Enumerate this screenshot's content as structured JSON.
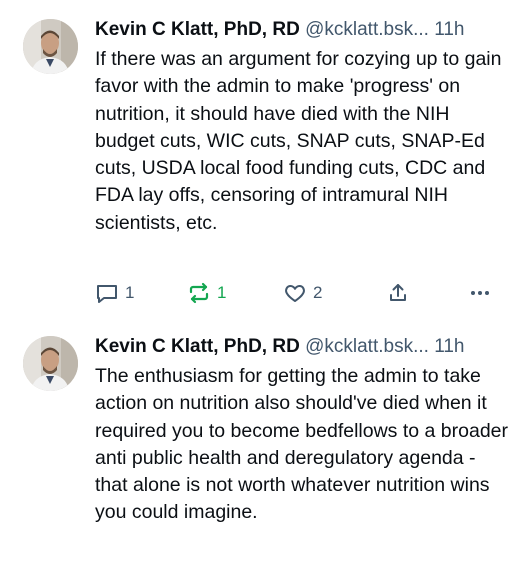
{
  "posts": [
    {
      "author": "Kevin C Klatt, PhD, RD",
      "handle": "@kcklatt.bsk...",
      "separator": " ",
      "time": "11h",
      "body": "If there was an argument for cozying up to gain favor with the admin to make 'progress' on nutrition, it should have died with the NIH budget cuts, WIC cuts, SNAP cuts, SNAP-Ed cuts, USDA local food funding cuts, CDC and FDA lay offs, censoring of intramural NIH scientists, etc.",
      "actions": {
        "reply_count": "1",
        "repost_count": "1",
        "like_count": "2"
      },
      "icons": {
        "reply": "comment-icon",
        "repost": "repost-icon",
        "like": "heart-icon",
        "share": "share-icon",
        "more": "more-dots-icon"
      },
      "colors": {
        "repost_active": "#13a650",
        "muted": "#42576c"
      }
    },
    {
      "author": "Kevin C Klatt, PhD, RD",
      "handle": "@kcklatt.bsk...",
      "separator": " ",
      "time": "11h",
      "body": "The enthusiasm for getting the admin to take action on nutrition also should've died when it required you to become bedfellows to a broader anti public health and deregulatory agenda - that alone is not worth whatever nutrition wins you could imagine."
    }
  ]
}
